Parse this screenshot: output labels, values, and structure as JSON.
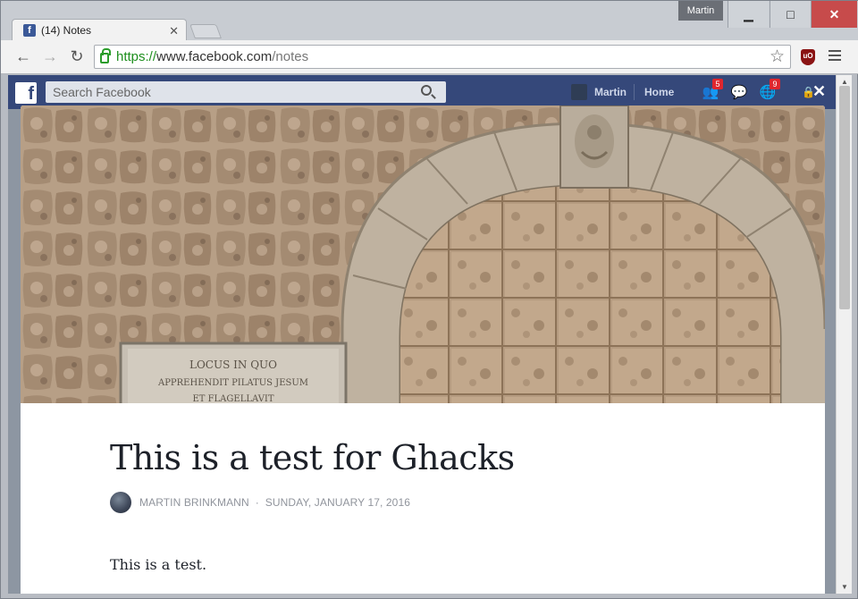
{
  "window": {
    "user": "Martin",
    "minimize": "▁",
    "maximize": "□",
    "close": "✕"
  },
  "tab": {
    "favicon": "f",
    "title": "(14) Notes",
    "close": "✕"
  },
  "toolbar": {
    "back": "←",
    "forward": "→",
    "reload": "↻",
    "url_protocol": "https://",
    "url_host": "www.facebook.com",
    "url_path": "/notes",
    "star": "☆",
    "extension": "uO"
  },
  "facebook": {
    "logo": "f",
    "search_placeholder": "Search Facebook",
    "profile_name": "Martin",
    "home": "Home",
    "friends_icon": "👥",
    "friends_count": "5",
    "messages_icon": "💬",
    "notifications_icon": "🌐",
    "notifications_count": "9",
    "lock": "🔒"
  },
  "note": {
    "close": "✕",
    "plaque_line1": "LOCUS IN QUO",
    "plaque_line2": "APPREHENDIT PILATUS JESUM",
    "plaque_line3": "ET FLAGELLAVIT",
    "title": "This is a test for Ghacks",
    "author": "MARTIN BRINKMANN",
    "separator": "·",
    "date": "SUNDAY, JANUARY 17, 2016",
    "body": "This is a test."
  }
}
